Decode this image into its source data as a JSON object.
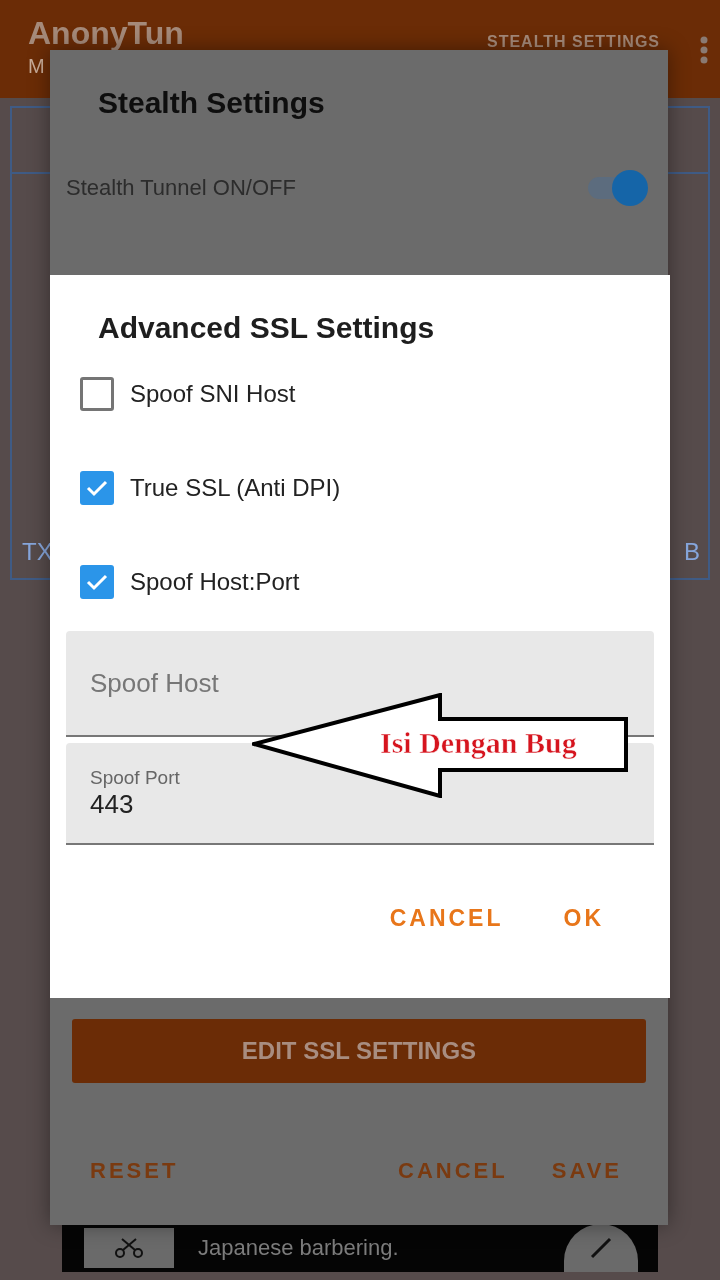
{
  "app_bar": {
    "title": "AnonyTun",
    "subtitle": "M",
    "action": "STEALTH SETTINGS"
  },
  "panel": {
    "left_label": "TX",
    "right_label": "B"
  },
  "ad": {
    "text": "Japanese barbering."
  },
  "stealth_dialog": {
    "title": "Stealth Settings",
    "toggle": {
      "label": "Stealth Tunnel ON/OFF",
      "on": true
    },
    "edit_button": "EDIT SSL SETTINGS",
    "buttons": [
      {
        "label": "RESET",
        "kind": "left"
      },
      {
        "label": "CANCEL",
        "kind": "right"
      },
      {
        "label": "SAVE",
        "kind": "right"
      }
    ]
  },
  "ssl_dialog": {
    "title": "Advanced SSL Settings",
    "options": [
      {
        "label": "Spoof SNI Host",
        "checked": false
      },
      {
        "label": "True SSL (Anti DPI)",
        "checked": true
      },
      {
        "label": "Spoof Host:Port",
        "checked": true
      }
    ],
    "fields": [
      {
        "placeholder": "Spoof Host"
      },
      {
        "label": "Spoof Port",
        "value": "443"
      }
    ],
    "buttons": [
      "CANCEL",
      "OK"
    ]
  },
  "annotation": {
    "text": "Isi Dengan Bug"
  }
}
